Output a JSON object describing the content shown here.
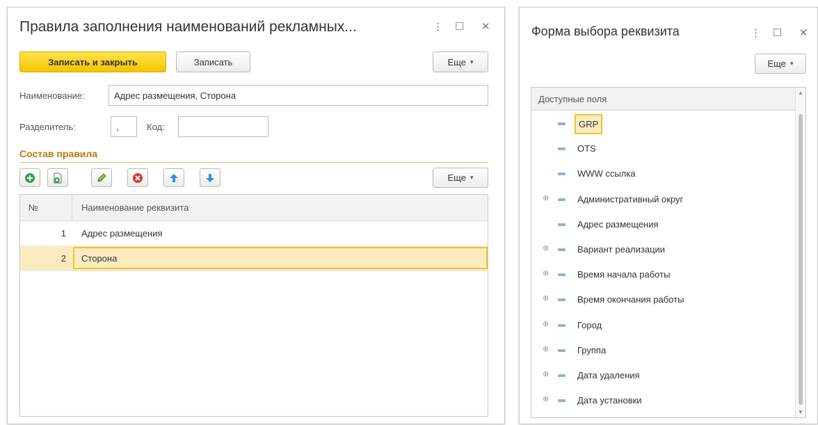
{
  "window1": {
    "title": "Правила заполнения наименований рекламных...",
    "controls": {
      "more": "⋮",
      "maximize": "☐",
      "close": "✕"
    },
    "toolbar": {
      "save_close_label": "Записать и закрыть",
      "save_label": "Записать",
      "more_label": "Еще"
    },
    "fields": {
      "name_label": "Наименование:",
      "name_value": "Адрес размещения,  Сторона",
      "separator_label": "Разделитель:",
      "separator_value": ",",
      "code_label": "Код:",
      "code_value": ""
    },
    "group_title": "Состав правила",
    "table_toolbar": {
      "icons": [
        "add-icon",
        "copy-icon",
        "edit-icon",
        "delete-icon",
        "move-up-icon",
        "move-down-icon"
      ],
      "more_label": "Еще"
    },
    "table": {
      "columns": [
        "№",
        "Наименование реквизита"
      ],
      "rows": [
        {
          "num": "1",
          "name": "Адрес размещения"
        },
        {
          "num": "2",
          "name": "Сторона"
        }
      ],
      "selected_row": 2
    }
  },
  "window2": {
    "title": "Форма выбора реквизита",
    "controls": {
      "more": "⋮",
      "maximize": "☐",
      "close": "✕"
    },
    "more_label": "Еще",
    "tree": {
      "header": "Доступные поля",
      "items": [
        {
          "label": "GRP",
          "expandable": false,
          "selected": true
        },
        {
          "label": "OTS",
          "expandable": false
        },
        {
          "label": "WWW ссылка",
          "expandable": false
        },
        {
          "label": "Административный округ",
          "expandable": true
        },
        {
          "label": "Адрес размещения",
          "expandable": false
        },
        {
          "label": "Вариант реализации",
          "expandable": true
        },
        {
          "label": "Время начала работы",
          "expandable": true
        },
        {
          "label": "Время окончания работы",
          "expandable": true
        },
        {
          "label": "Город",
          "expandable": true
        },
        {
          "label": "Группа",
          "expandable": true
        },
        {
          "label": "Дата удаления",
          "expandable": true
        },
        {
          "label": "Дата установки",
          "expandable": true
        }
      ]
    }
  },
  "colors": {
    "accent": "#f5c400",
    "selection": "#fbecc0",
    "group_title": "#b47c10"
  }
}
